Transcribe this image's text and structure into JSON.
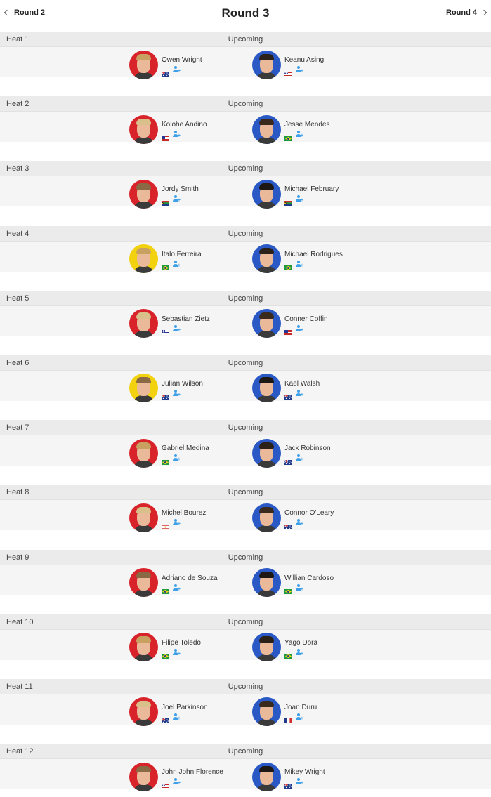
{
  "nav": {
    "prev_label": "Round 2",
    "title": "Round 3",
    "next_label": "Round 4"
  },
  "colors": {
    "red_jersey": "#d8232a",
    "blue_jersey": "#2a59c6",
    "yellow_jersey": "#f2d10e",
    "header_bg": "#ebebeb",
    "row_bg": "#f5f5f5",
    "follow_icon": "#3fa0e8"
  },
  "heats": [
    {
      "name": "Heat 1",
      "status": "Upcoming",
      "athletes": [
        {
          "name": "Owen Wright",
          "country": "AUS",
          "jersey": "red"
        },
        {
          "name": "Keanu Asing",
          "country": "HAW",
          "jersey": "blue"
        }
      ]
    },
    {
      "name": "Heat 2",
      "status": "Upcoming",
      "athletes": [
        {
          "name": "Kolohe Andino",
          "country": "USA",
          "jersey": "red"
        },
        {
          "name": "Jesse Mendes",
          "country": "BRA",
          "jersey": "blue"
        }
      ]
    },
    {
      "name": "Heat 3",
      "status": "Upcoming",
      "athletes": [
        {
          "name": "Jordy Smith",
          "country": "ZAF",
          "jersey": "red"
        },
        {
          "name": "Michael February",
          "country": "ZAF",
          "jersey": "blue"
        }
      ]
    },
    {
      "name": "Heat 4",
      "status": "Upcoming",
      "athletes": [
        {
          "name": "Italo Ferreira",
          "country": "BRA",
          "jersey": "yellow"
        },
        {
          "name": "Michael Rodrigues",
          "country": "BRA",
          "jersey": "blue"
        }
      ]
    },
    {
      "name": "Heat 5",
      "status": "Upcoming",
      "athletes": [
        {
          "name": "Sebastian Zietz",
          "country": "HAW",
          "jersey": "red"
        },
        {
          "name": "Conner Coffin",
          "country": "USA",
          "jersey": "blue"
        }
      ]
    },
    {
      "name": "Heat 6",
      "status": "Upcoming",
      "athletes": [
        {
          "name": "Julian Wilson",
          "country": "AUS",
          "jersey": "yellow"
        },
        {
          "name": "Kael Walsh",
          "country": "AUS",
          "jersey": "blue"
        }
      ]
    },
    {
      "name": "Heat 7",
      "status": "Upcoming",
      "athletes": [
        {
          "name": "Gabriel Medina",
          "country": "BRA",
          "jersey": "red"
        },
        {
          "name": "Jack Robinson",
          "country": "AUS",
          "jersey": "blue"
        }
      ]
    },
    {
      "name": "Heat 8",
      "status": "Upcoming",
      "athletes": [
        {
          "name": "Michel Bourez",
          "country": "PYF",
          "jersey": "red"
        },
        {
          "name": "Connor O'Leary",
          "country": "AUS",
          "jersey": "blue"
        }
      ]
    },
    {
      "name": "Heat 9",
      "status": "Upcoming",
      "athletes": [
        {
          "name": "Adriano de Souza",
          "country": "BRA",
          "jersey": "red"
        },
        {
          "name": "Willian Cardoso",
          "country": "BRA",
          "jersey": "blue"
        }
      ]
    },
    {
      "name": "Heat 10",
      "status": "Upcoming",
      "athletes": [
        {
          "name": "Filipe Toledo",
          "country": "BRA",
          "jersey": "red"
        },
        {
          "name": "Yago Dora",
          "country": "BRA",
          "jersey": "blue"
        }
      ]
    },
    {
      "name": "Heat 11",
      "status": "Upcoming",
      "athletes": [
        {
          "name": "Joel Parkinson",
          "country": "AUS",
          "jersey": "red"
        },
        {
          "name": "Joan Duru",
          "country": "FRA",
          "jersey": "blue"
        }
      ]
    },
    {
      "name": "Heat 12",
      "status": "Upcoming",
      "athletes": [
        {
          "name": "John John Florence",
          "country": "HAW",
          "jersey": "red"
        },
        {
          "name": "Mikey Wright",
          "country": "AUS",
          "jersey": "blue"
        }
      ]
    }
  ]
}
